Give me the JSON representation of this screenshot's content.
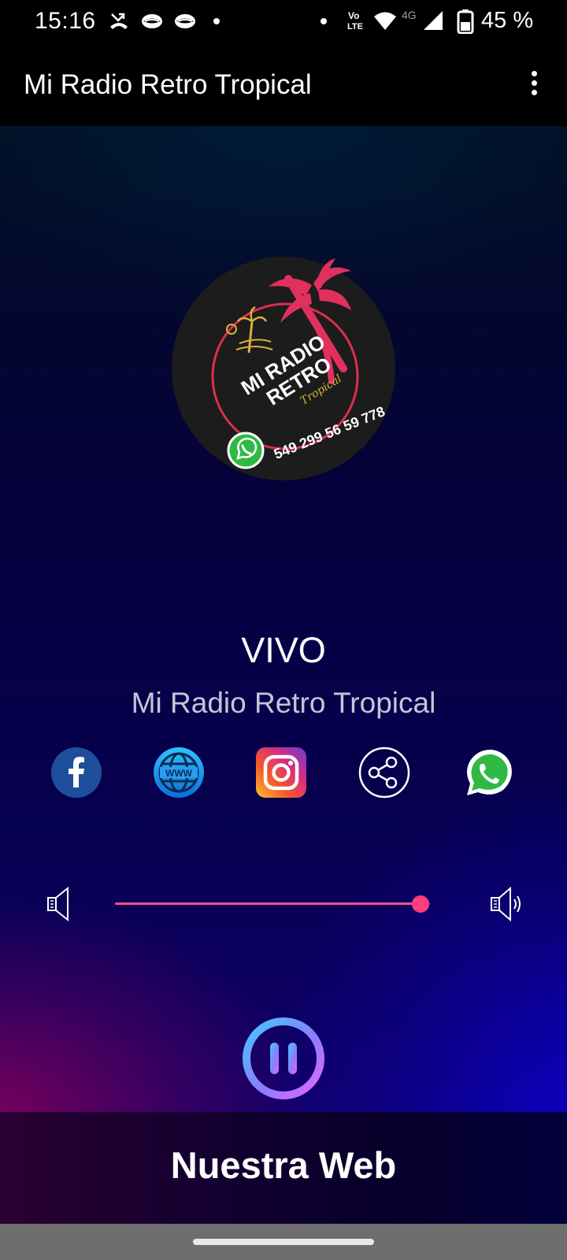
{
  "status_bar": {
    "time": "15:16",
    "battery_text": "45 %",
    "network_label": "4G",
    "volte_label_top": "Vo",
    "volte_label_bottom": "LTE"
  },
  "app_bar": {
    "title": "Mi Radio Retro Tropical"
  },
  "logo": {
    "line1": "MI RADIO",
    "line2": "RETRO",
    "script": "Tropical",
    "phone": "549 299 56 59 778",
    "colors": {
      "palm": "#e0305e",
      "ring": "#d9304f",
      "gold": "#d8b13c",
      "disc": "#1c1c1c"
    }
  },
  "player": {
    "status": "VIVO",
    "station": "Mi Radio Retro Tropical",
    "volume_percent": 100,
    "accent_color": "#ff3d7f"
  },
  "social_links": [
    {
      "name": "facebook-icon"
    },
    {
      "name": "website-icon",
      "label": "WWW"
    },
    {
      "name": "instagram-icon"
    },
    {
      "name": "share-icon"
    },
    {
      "name": "whatsapp-icon"
    }
  ],
  "bottom_banner": {
    "label": "Nuestra Web"
  }
}
